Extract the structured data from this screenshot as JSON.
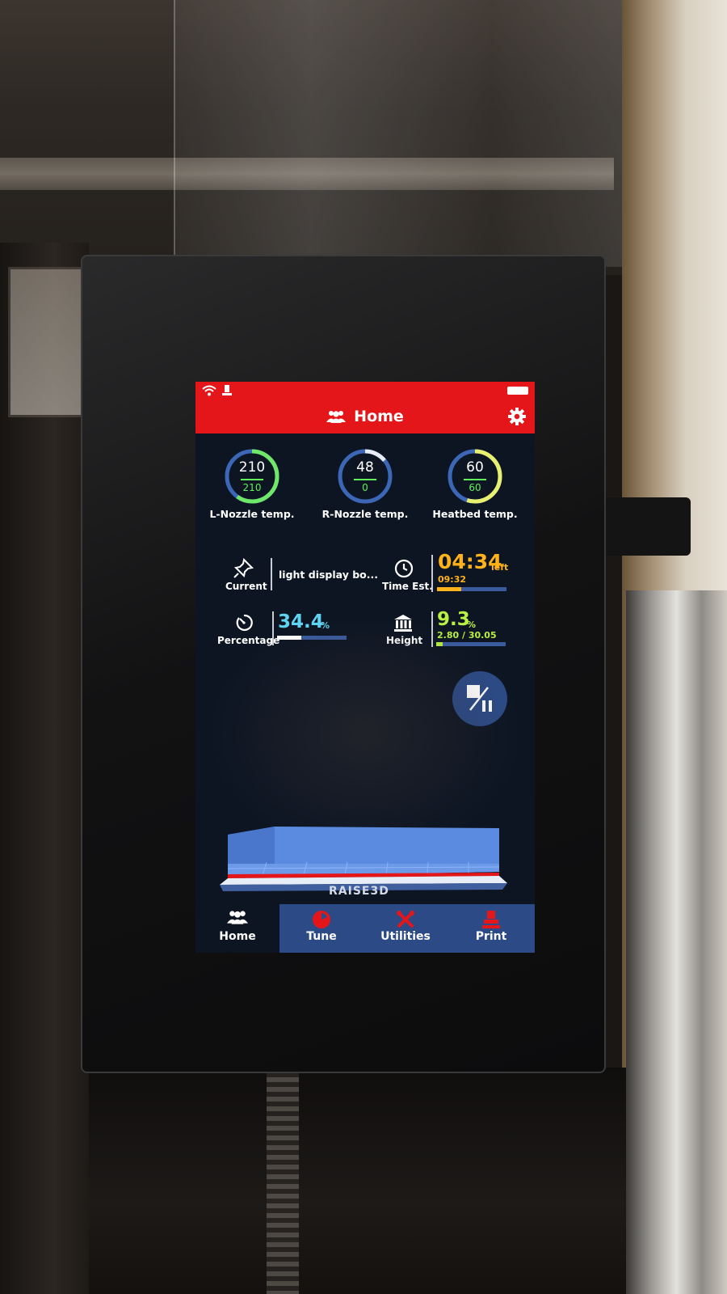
{
  "header": {
    "title": "Home"
  },
  "gauges": [
    {
      "label": "L-Nozzle temp.",
      "current": "210",
      "target": "210",
      "fraction": 0.6
    },
    {
      "label": "R-Nozzle temp.",
      "current": "48",
      "target": "0",
      "fraction": 0.14
    },
    {
      "label": "Heatbed temp.",
      "current": "60",
      "target": "60",
      "fraction": 0.55
    }
  ],
  "info": {
    "current": {
      "label": "Current",
      "value": "light display bo..."
    },
    "time_est": {
      "label": "Time Est.",
      "remaining": "04:34",
      "remaining_suffix": "left",
      "elapsed": "09:32",
      "progress": 0.35
    },
    "percentage": {
      "label": "Percentage",
      "value": "34.4",
      "unit": "%",
      "progress": 0.344
    },
    "height": {
      "label": "Height",
      "value": "9.3",
      "unit": "%",
      "detail": "2.80 / 30.05",
      "progress": 0.093
    }
  },
  "brand": "RAISE3D",
  "nav": {
    "home": "Home",
    "tune": "Tune",
    "utilities": "Utilities",
    "print": "Print"
  },
  "colors": {
    "accent_red": "#e5161a",
    "nav_blue": "#2b4a86",
    "time_orange": "#ffb21a",
    "percent_cyan": "#5fd4f2",
    "height_green": "#b8f043",
    "gauge_green": "#5ff05a"
  },
  "icons": {
    "status": [
      "wifi-icon",
      "usb-icon",
      "battery-icon"
    ],
    "title": "users-icon",
    "settings": "gear-icon",
    "info": [
      "pin-icon",
      "clock-icon",
      "timer-icon",
      "building-icon"
    ],
    "nav": [
      "users-icon",
      "tune-icon",
      "tools-icon",
      "print-icon"
    ],
    "control": "stop-pause-icon"
  }
}
